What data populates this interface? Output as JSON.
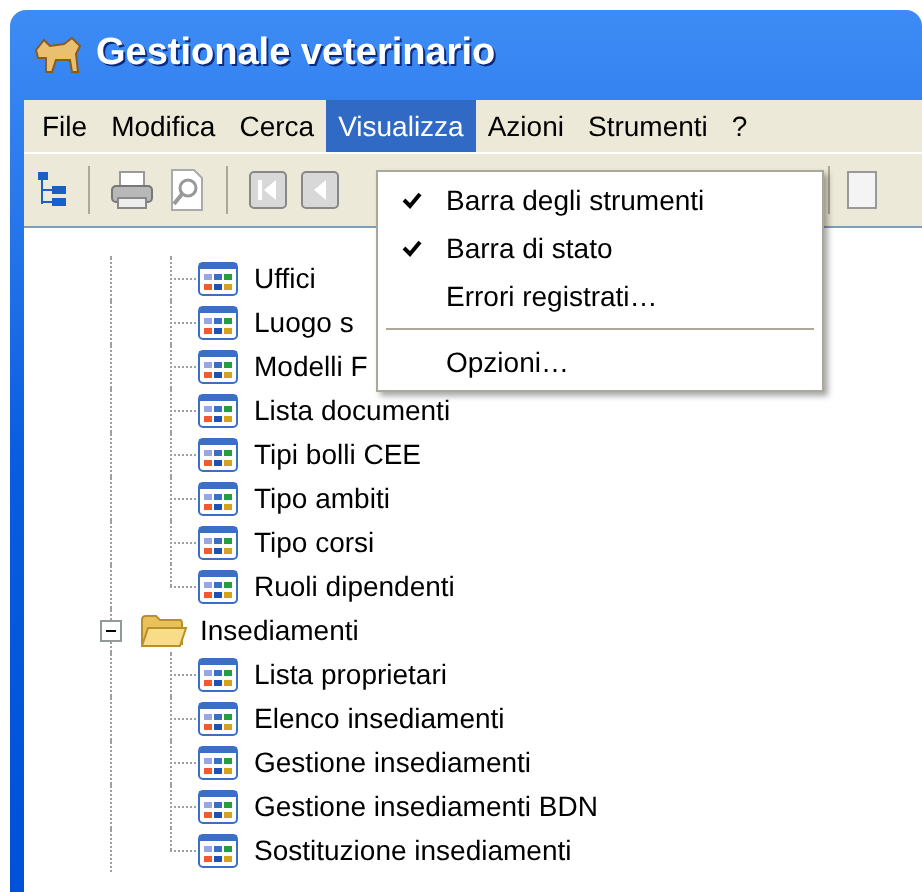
{
  "window": {
    "title": "Gestionale veterinario"
  },
  "menu_bar": [
    {
      "label": "File",
      "selected": false
    },
    {
      "label": "Modifica",
      "selected": false
    },
    {
      "label": "Cerca",
      "selected": false
    },
    {
      "label": "Visualizza",
      "selected": true
    },
    {
      "label": "Azioni",
      "selected": false
    },
    {
      "label": "Strumenti",
      "selected": false
    },
    {
      "label": "?",
      "selected": false
    }
  ],
  "dropdown": {
    "items": [
      {
        "kind": "option",
        "label": "Barra degli strumenti",
        "checked": true
      },
      {
        "kind": "option",
        "label": "Barra di stato",
        "checked": true
      },
      {
        "kind": "option",
        "label": "Errori registrati…",
        "checked": false
      },
      {
        "kind": "separator"
      },
      {
        "kind": "option",
        "label": "Opzioni…",
        "checked": false
      }
    ]
  },
  "tree": {
    "items": [
      {
        "kind": "offscreen_folder",
        "children": [
          {
            "label": "Uffici"
          },
          {
            "label": "Luogo s"
          },
          {
            "label": "Modelli F"
          },
          {
            "label": "Lista documenti"
          },
          {
            "label": "Tipi bolli CEE"
          },
          {
            "label": "Tipo ambiti"
          },
          {
            "label": "Tipo corsi"
          },
          {
            "label": "Ruoli dipendenti"
          }
        ]
      },
      {
        "kind": "folder",
        "label": "Insediamenti",
        "expanded": true,
        "children": [
          {
            "label": "Lista proprietari"
          },
          {
            "label": "Elenco insediamenti"
          },
          {
            "label": "Gestione insediamenti"
          },
          {
            "label": "Gestione insediamenti BDN"
          },
          {
            "label": "Sostituzione insediamenti"
          }
        ]
      }
    ]
  }
}
